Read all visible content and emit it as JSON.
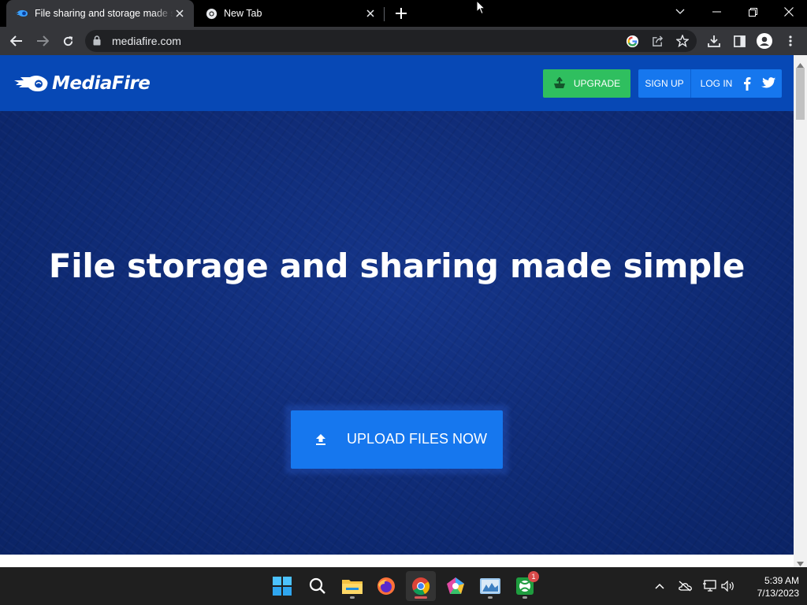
{
  "browser": {
    "tabs": [
      {
        "title": "File sharing and storage made simple",
        "active": true,
        "icon": "mediafire-favicon"
      },
      {
        "title": "New Tab",
        "active": false,
        "icon": "chrome-icon"
      }
    ],
    "url": "mediafire.com"
  },
  "site": {
    "logo_text": "MediaFire",
    "upgrade_label": "UPGRADE",
    "signup_label": "SIGN UP",
    "login_label": "LOG IN",
    "hero_title": "File storage and sharing made simple",
    "upload_label": "UPLOAD FILES NOW"
  },
  "taskbar": {
    "apps": [
      "start-icon",
      "search-icon",
      "file-explorer-icon",
      "firefox-icon",
      "chrome-icon",
      "app-pentagon-icon",
      "image-viewer-icon",
      "xbox-icon"
    ],
    "xbox_badge": "1",
    "time": "5:39 AM",
    "date": "7/13/2023"
  },
  "colors": {
    "header_blue": "#0748b5",
    "hero_navy": "#0e2a78",
    "button_blue": "#1677ee",
    "upgrade_green": "#2fbf5f"
  }
}
